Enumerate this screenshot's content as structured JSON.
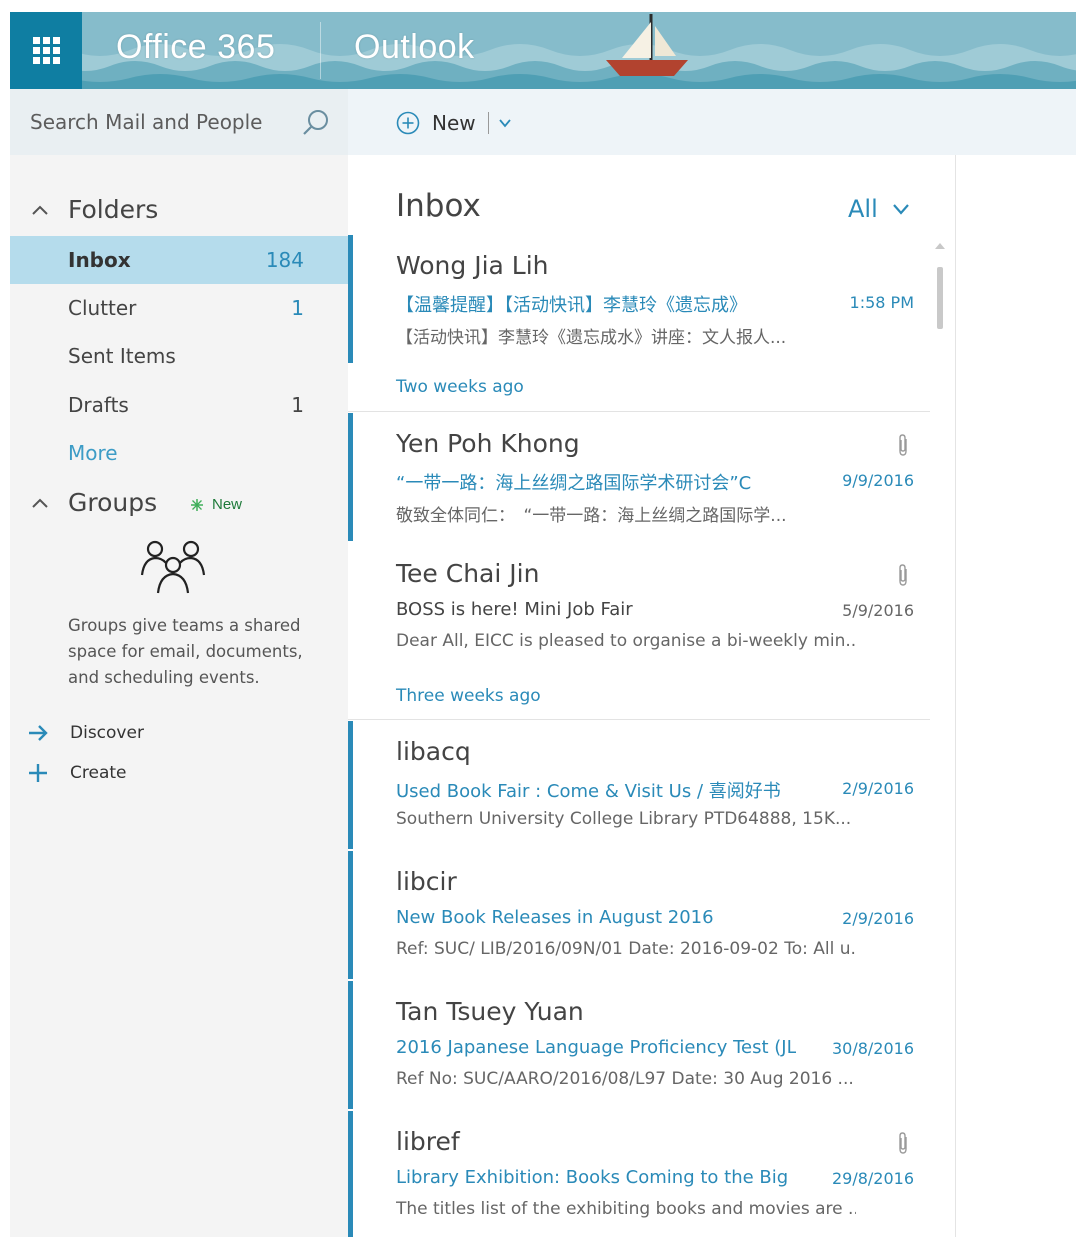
{
  "header": {
    "suite_name": "Office 365",
    "app_name": "Outlook",
    "app_launcher_icon": "waffle-grid-icon",
    "banner_theme": "sailboat-on-waves",
    "colors": {
      "launcher_bg": "#0f7ea2",
      "banner_bg": "#7fb6c4",
      "accent": "#2a8ab8"
    }
  },
  "search": {
    "placeholder": "Search Mail and People",
    "icon": "search-icon"
  },
  "toolbar": {
    "new_label": "New",
    "new_icon": "plus-circle-icon",
    "dropdown_icon": "chevron-down-icon"
  },
  "sidebar": {
    "folders_header": "Folders",
    "folders": [
      {
        "label": "Inbox",
        "count": "184",
        "selected": true
      },
      {
        "label": "Clutter",
        "count": "1"
      },
      {
        "label": "Sent Items",
        "count": ""
      },
      {
        "label": "Drafts",
        "count": "1"
      }
    ],
    "more_label": "More",
    "groups_header": "Groups",
    "groups_new_badge": "New",
    "groups_description": "Groups give teams a shared space for email, documents, and scheduling events.",
    "actions": [
      {
        "label": "Discover",
        "icon": "arrow-right-icon"
      },
      {
        "label": "Create",
        "icon": "plus-icon"
      }
    ]
  },
  "message_list": {
    "title": "Inbox",
    "filter_label": "All",
    "group_headers": [
      "Two weeks ago",
      "Three weeks ago"
    ],
    "messages": [
      {
        "from": "Wong Jia Lih",
        "subject": "【温馨提醒】【活动快讯】李慧玲《遗忘成》",
        "date": "1:58 PM",
        "preview": "【活动快讯】李慧玲《遗忘成水》讲座：文人报人...",
        "unread": true,
        "attachment": false
      },
      {
        "from": "Yen Poh Khong",
        "subject": "“一带一路：海上丝绸之路国际学术研讨会”C",
        "date": "9/9/2016",
        "preview": "敬致全体同仁：　“一带一路：海上丝绸之路国际学...",
        "unread": true,
        "attachment": true
      },
      {
        "from": "Tee Chai Jin",
        "subject": "BOSS is here! Mini Job Fair",
        "date": "5/9/2016",
        "preview": "Dear All,  EICC is pleased to organise a bi-weekly min...",
        "unread": false,
        "attachment": true
      },
      {
        "from": "libacq",
        "subject": "Used Book Fair : Come & Visit Us / 喜阅好书",
        "date": "2/9/2016",
        "preview": "Southern University College Library  PTD64888, 15K...",
        "unread": true,
        "attachment": false
      },
      {
        "from": "libcir",
        "subject": "New Book Releases in August 2016",
        "date": "2/9/2016",
        "preview": "Ref: SUC/ LIB/2016/09N/01 Date: 2016-09-02 To: All u...",
        "unread": true,
        "attachment": false
      },
      {
        "from": "Tan Tsuey Yuan",
        "subject": "2016 Japanese Language Proficiency Test (JL",
        "date": "30/8/2016",
        "preview": "Ref No: SUC/AARO/2016/08/L97 Date: 30 Aug 2016  ...",
        "unread": true,
        "attachment": false
      },
      {
        "from": "libref",
        "subject": "Library Exhibition: Books Coming to the Big",
        "date": "29/8/2016",
        "preview": "The titles list of the exhibiting books and movies are ...",
        "unread": true,
        "attachment": true
      }
    ]
  }
}
